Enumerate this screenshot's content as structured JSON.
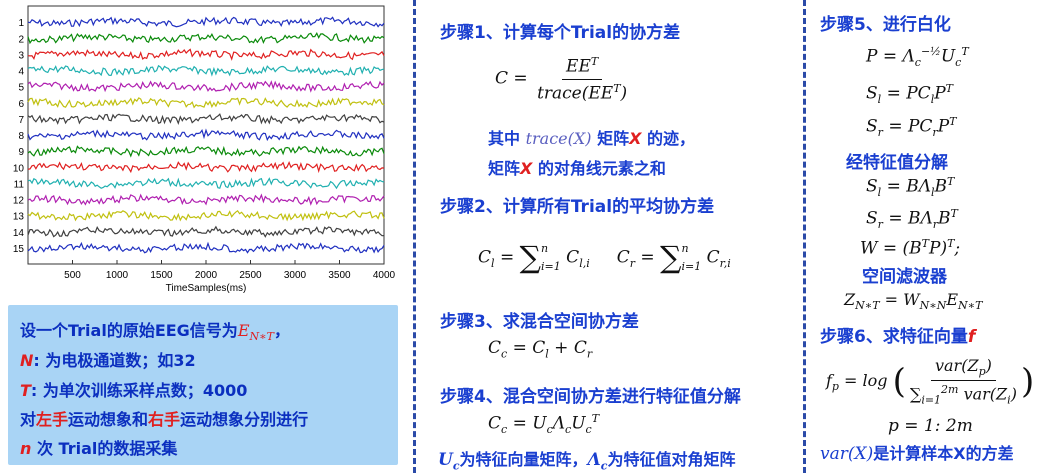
{
  "eeg_plot": {
    "channels": [
      "1",
      "2",
      "3",
      "4",
      "5",
      "6",
      "7",
      "8",
      "9",
      "10",
      "11",
      "12",
      "13",
      "14",
      "15"
    ],
    "colors": [
      "#2030c0",
      "#0a8a0a",
      "#e02020",
      "#20b0b0",
      "#b020b0",
      "#c0c010",
      "#404040",
      "#2030c0",
      "#0a8a0a",
      "#e02020",
      "#20b0b0",
      "#b020b0",
      "#c0c010",
      "#404040",
      "#2030c0"
    ],
    "x_ticks": [
      "500",
      "1000",
      "1500",
      "2000",
      "2500",
      "3000",
      "3500",
      "4000"
    ],
    "xlabel": "TimeSamples(ms)"
  },
  "info_box": {
    "line1": "设一个Trial的原始EEG信号为",
    "line1_sym": "E",
    "line1_sub": "N∗T",
    "line1_end": "，",
    "line2_sym": "N",
    "line2_text": ": 为电极通道数；如32",
    "line3_sym": "T",
    "line3_text": ": 为单次训练采样点数；4000",
    "line4_a": "对",
    "line4_left": "左手",
    "line4_b": "运动想象和",
    "line4_right": "右手",
    "line4_c": "运动想象分别进行",
    "line5_n": "n",
    "line5_text": " 次 Trial",
    "line5_end": "的数据采集"
  },
  "middle": {
    "step1": "步骤1、计算每个Trial的协方差",
    "eq1_lhs": "C =",
    "eq1_num": "EE",
    "eq1_den": "trace(EE",
    "note1_a": "其中 ",
    "note1_math": "trace(X)",
    "note1_b": " 矩阵",
    "note1_x": "X",
    "note1_c": " 的迹，",
    "note2_a": "矩阵",
    "note2_x": "X",
    "note2_b": " 的对角线元素之和",
    "step2": "步骤2、计算所有Trial的平均协方差",
    "step3": "步骤3、求混合空间协方差",
    "eq3": "C",
    "step4": "步骤4、混合空间协方差进行特征值分解",
    "bottom_a": "为特征向量矩阵，",
    "bottom_b": "为特征值对角矩阵"
  },
  "right": {
    "step5": "步骤5、进行白化",
    "eig_title": "经特征值分解",
    "filter_title": "空间滤波器",
    "step6": "步骤6、求特征向量",
    "step6_f": "f",
    "p_range": "p = 1: 2m",
    "var_note_math": "var(X)",
    "var_note_text": "是计算样本X的方差"
  }
}
